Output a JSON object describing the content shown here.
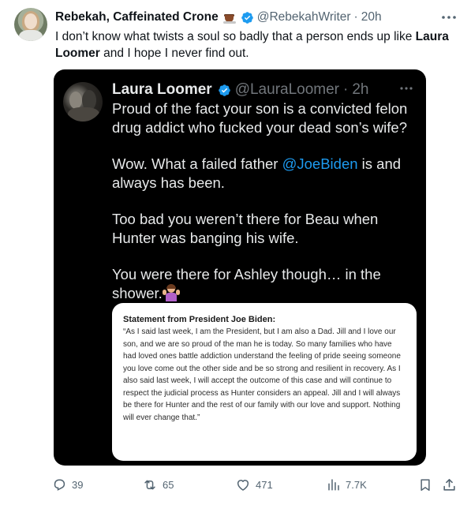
{
  "author": {
    "name": "Rebekah, Caffeinated Crone",
    "handle": "@RebekahWriter",
    "separator": "·",
    "time": "20h"
  },
  "tweet": {
    "text_part1": "I don’t know what twists a soul so badly that a person ends up like ",
    "bold_name": "Laura Loomer",
    "text_part2": " and I hope I never find out."
  },
  "quoted": {
    "name": "Laura Loomer",
    "handle": "@LauraLoomer",
    "separator": "·",
    "time": "2h",
    "paragraph1": "Proud of the fact your son is a convicted felon drug addict who fucked your dead son’s wife?",
    "paragraph2_before": "Wow. What a failed father ",
    "paragraph2_mention": "@JoeBiden",
    "paragraph2_after": " is and always has been.",
    "paragraph3": "Too bad you weren’t there for Beau when Hunter was banging his wife.",
    "paragraph4": "You were there for Ashley though… in the shower."
  },
  "statement": {
    "title": "Statement from President Joe Biden:",
    "body": "“As I said last week, I am the President, but I am also a Dad. Jill and I love our son, and we are so proud of the man he is today. So many families who have had loved ones battle addiction understand the feeling of pride seeing someone you love come out the other side and be so strong and resilient in recovery. As I also said last week, I will accept the outcome of this case and will continue to respect the judicial process as Hunter considers an appeal. Jill and I will always be there for Hunter and the rest of our family with our love and support. Nothing will ever change that.”"
  },
  "actions": {
    "replies": "39",
    "reposts": "65",
    "likes": "471",
    "views": "7.7K"
  },
  "icons": {
    "verified": "verified-badge-icon",
    "more": "more-options-icon",
    "reply": "reply-icon",
    "repost": "repost-icon",
    "like": "heart-icon",
    "views": "views-chart-icon",
    "bookmark": "bookmark-icon",
    "share": "share-icon"
  },
  "colors": {
    "accent": "#1d9bf0",
    "muted": "#536471",
    "quote_bg": "#000000"
  }
}
